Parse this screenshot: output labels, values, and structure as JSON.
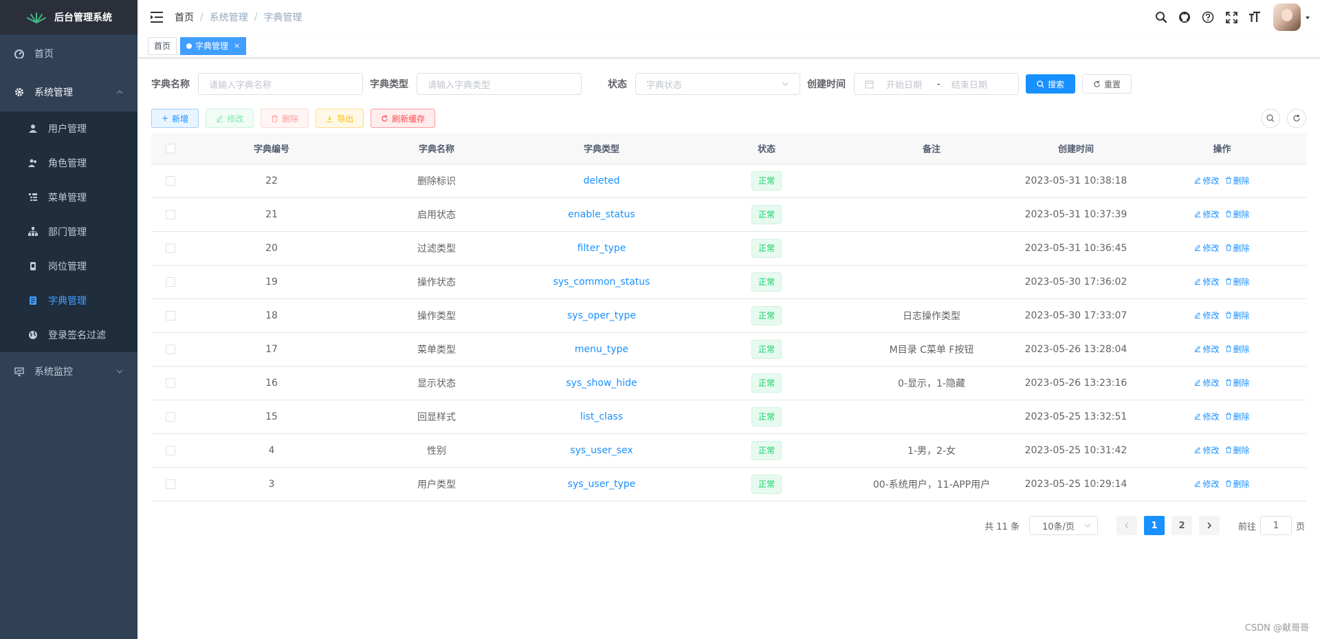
{
  "app": {
    "title": "后台管理系统"
  },
  "sidebar": {
    "home": "首页",
    "system": "系统管理",
    "items": [
      "用户管理",
      "角色管理",
      "菜单管理",
      "部门管理",
      "岗位管理",
      "字典管理",
      "登录签名过滤"
    ],
    "monitor": "系统监控"
  },
  "breadcrumb": [
    "首页",
    "系统管理",
    "字典管理"
  ],
  "tags": {
    "home": "首页",
    "current": "字典管理",
    "close": "×"
  },
  "search": {
    "name_label": "字典名称",
    "name_placeholder": "请输入字典名称",
    "type_label": "字典类型",
    "type_placeholder": "请输入字典类型",
    "status_label": "状态",
    "status_placeholder": "字典状态",
    "time_label": "创建时间",
    "start_placeholder": "开始日期",
    "range_sep": "-",
    "end_placeholder": "结束日期",
    "search_btn": "搜索",
    "reset_btn": "重置"
  },
  "toolbar": {
    "add": "新增",
    "edit": "修改",
    "delete": "删除",
    "export": "导出",
    "refresh": "刷新缓存"
  },
  "table": {
    "headers": [
      "字典编号",
      "字典名称",
      "字典类型",
      "状态",
      "备注",
      "创建时间",
      "操作"
    ],
    "rows": [
      {
        "id": "22",
        "name": "删除标识",
        "type": "deleted",
        "status": "正常",
        "remark": "",
        "created": "2023-05-31 10:38:18"
      },
      {
        "id": "21",
        "name": "启用状态",
        "type": "enable_status",
        "status": "正常",
        "remark": "",
        "created": "2023-05-31 10:37:39"
      },
      {
        "id": "20",
        "name": "过滤类型",
        "type": "filter_type",
        "status": "正常",
        "remark": "",
        "created": "2023-05-31 10:36:45"
      },
      {
        "id": "19",
        "name": "操作状态",
        "type": "sys_common_status",
        "status": "正常",
        "remark": "",
        "created": "2023-05-30 17:36:02"
      },
      {
        "id": "18",
        "name": "操作类型",
        "type": "sys_oper_type",
        "status": "正常",
        "remark": "日志操作类型",
        "created": "2023-05-30 17:33:07"
      },
      {
        "id": "17",
        "name": "菜单类型",
        "type": "menu_type",
        "status": "正常",
        "remark": "M目录 C菜单 F按钮",
        "created": "2023-05-26 13:28:04"
      },
      {
        "id": "16",
        "name": "显示状态",
        "type": "sys_show_hide",
        "status": "正常",
        "remark": "0-显示，1-隐藏",
        "created": "2023-05-26 13:23:16"
      },
      {
        "id": "15",
        "name": "回显样式",
        "type": "list_class",
        "status": "正常",
        "remark": "",
        "created": "2023-05-25 13:32:51"
      },
      {
        "id": "4",
        "name": "性别",
        "type": "sys_user_sex",
        "status": "正常",
        "remark": "1-男，2-女",
        "created": "2023-05-25 10:31:42"
      },
      {
        "id": "3",
        "name": "用户类型",
        "type": "sys_user_type",
        "status": "正常",
        "remark": "00-系统用户，11-APP用户",
        "created": "2023-05-25 10:29:14"
      }
    ],
    "op_edit": "修改",
    "op_delete": "删除"
  },
  "pagination": {
    "total": "共 11 条",
    "page_size": "10条/页",
    "pages": [
      "1",
      "2"
    ],
    "goto_label": "前往",
    "goto_value": "1",
    "page_unit": "页"
  },
  "watermark": "CSDN @献哥哥",
  "colors": {
    "sidebar_bg": "#304156",
    "primary": "#1890ff",
    "success": "#13ce66"
  }
}
